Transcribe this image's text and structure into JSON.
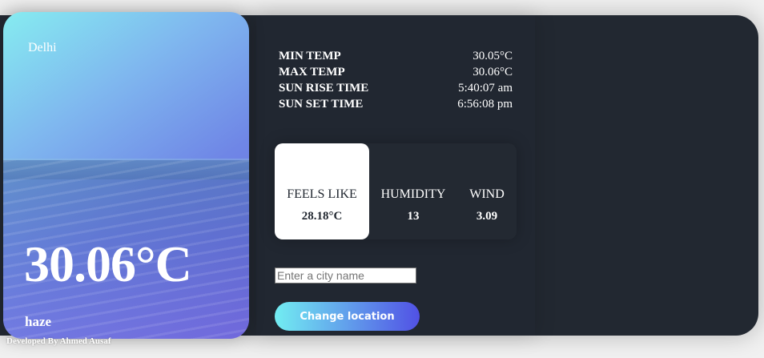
{
  "location": {
    "city": "Delhi",
    "temperature": "30.06°C",
    "condition": "haze"
  },
  "stats": [
    {
      "label": "MIN TEMP",
      "value": "30.05°C"
    },
    {
      "label": "MAX TEMP",
      "value": "30.06°C"
    },
    {
      "label": "SUN RISE TIME",
      "value": "5:40:07 am"
    },
    {
      "label": "SUN SET TIME",
      "value": "6:56:08 pm"
    }
  ],
  "metrics": [
    {
      "label": "FEELS LIKE",
      "value": "28.18°C"
    },
    {
      "label": "HUMIDITY",
      "value": "13"
    },
    {
      "label": "WIND",
      "value": "3.09"
    }
  ],
  "search": {
    "placeholder": "Enter a city name",
    "value": ""
  },
  "actions": {
    "change_location_label": "Change location"
  },
  "footer": {
    "credit": "Developed By Ahmed Ausaf"
  },
  "colors": {
    "panel_background": "#222831",
    "gradient_start": "#72edf2",
    "gradient_end": "#5151e5"
  }
}
